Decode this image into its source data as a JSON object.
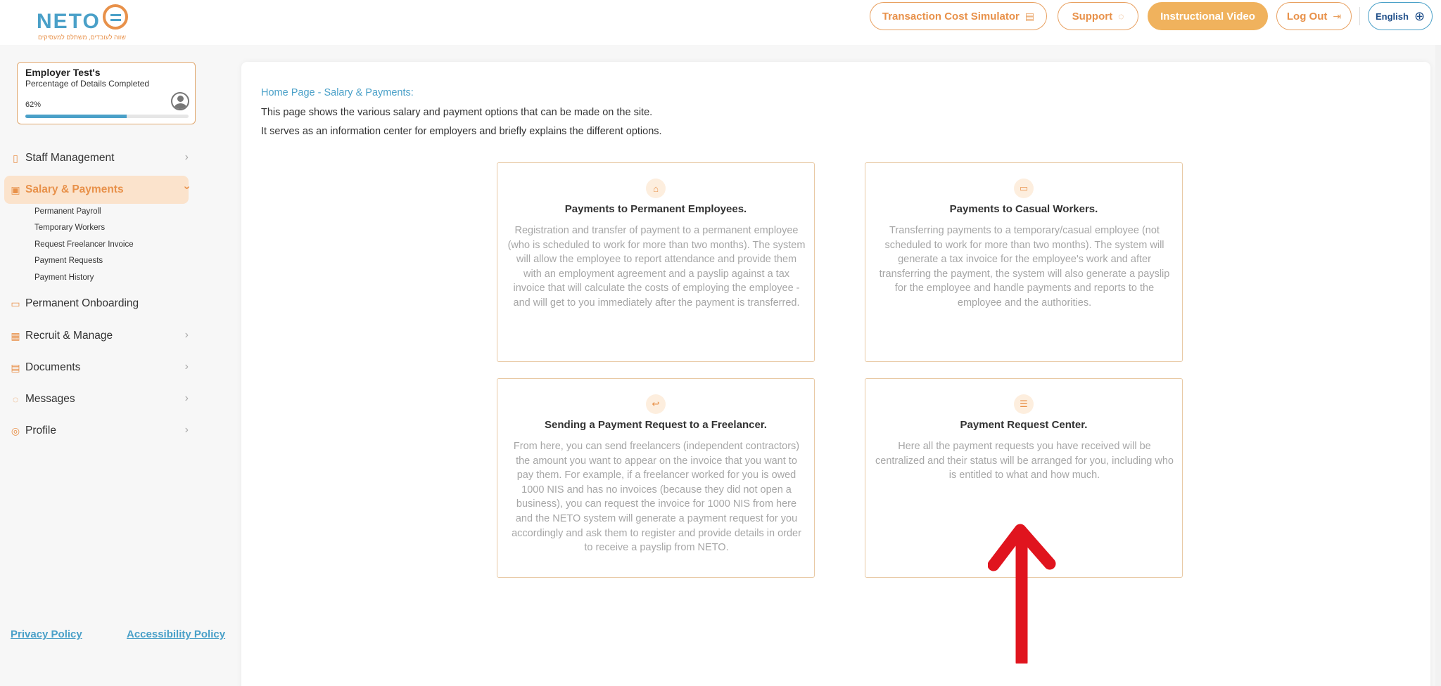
{
  "header": {
    "logo_text": "NETO",
    "logo_subtitle": "שווה לעובדים, משתלם למעסיקים",
    "transaction_cost_simulator": "Transaction Cost Simulator",
    "support": "Support",
    "instructional_video": "Instructional Video",
    "log_out": "Log Out",
    "language": "English"
  },
  "employer_card": {
    "name": "Employer Test's",
    "subtitle": "Percentage of Details Completed",
    "percent_label": "62%",
    "progress": 0.62
  },
  "sidebar": {
    "items": [
      {
        "label": "Staff Management",
        "icon": "document-icon"
      },
      {
        "label": "Salary & Payments",
        "icon": "invoice-icon",
        "active": true
      },
      {
        "label": "Permanent Onboarding",
        "icon": "briefcase-icon"
      },
      {
        "label": "Recruit & Manage",
        "icon": "grid-icon"
      },
      {
        "label": "Documents",
        "icon": "folder-icon"
      },
      {
        "label": "Messages",
        "icon": "chat-icon"
      },
      {
        "label": "Profile",
        "icon": "user-icon"
      }
    ],
    "sub_items": [
      "Permanent Payroll",
      "Temporary Workers",
      "Request Freelancer Invoice",
      "Payment Requests",
      "Payment History"
    ]
  },
  "footer": {
    "privacy_policy": "Privacy Policy",
    "accessibility_policy": "Accessibility Policy"
  },
  "main": {
    "breadcrumb": "Home Page - Salary & Payments:",
    "intro_line_1": "This page shows the various salary and payment options that can be made on the site.",
    "intro_line_2": "It serves as an information center for employers and briefly explains the different options.",
    "cards": [
      {
        "icon": "sofa-icon",
        "title": "Payments to Permanent Employees.",
        "description": "Registration and transfer of payment to a permanent employee (who is scheduled to work for more than two months). The system will allow the employee to report attendance and provide them with an employment agreement and a payslip against a tax invoice that will calculate the costs of employing the employee - and will get to you immediately after the payment is transferred."
      },
      {
        "icon": "briefcase-icon",
        "title": "Payments to Casual Workers.",
        "description": "Transferring payments to a temporary/casual employee (not scheduled to work for more than two months). The system will generate a tax invoice for the employee's work and after transferring the payment, the system will also generate a payslip for the employee and handle payments and reports to the employee and the authorities."
      },
      {
        "icon": "send-request-icon",
        "title": "Sending a Payment Request to a Freelancer.",
        "description": "From here, you can send freelancers (independent contractors) the amount you want to appear on the invoice that you want to pay them. For example, if a freelancer worked for you is owed 1000 NIS and has no invoices (because they did not open a business), you can request the invoice for 1000 NIS from here and the NETO system will generate a payment request for you accordingly and ask them to register and provide details in order to receive a payslip from NETO."
      },
      {
        "icon": "list-icon",
        "title": "Payment Request Center.",
        "description": "Here all the payment requests you have received will be centralized and their status will be arranged for you, including who is entitled to what and how much."
      }
    ]
  },
  "colors": {
    "accent_orange": "#e8914a",
    "accent_blue": "#4aa0c8",
    "arrow_red": "#e0141e"
  }
}
